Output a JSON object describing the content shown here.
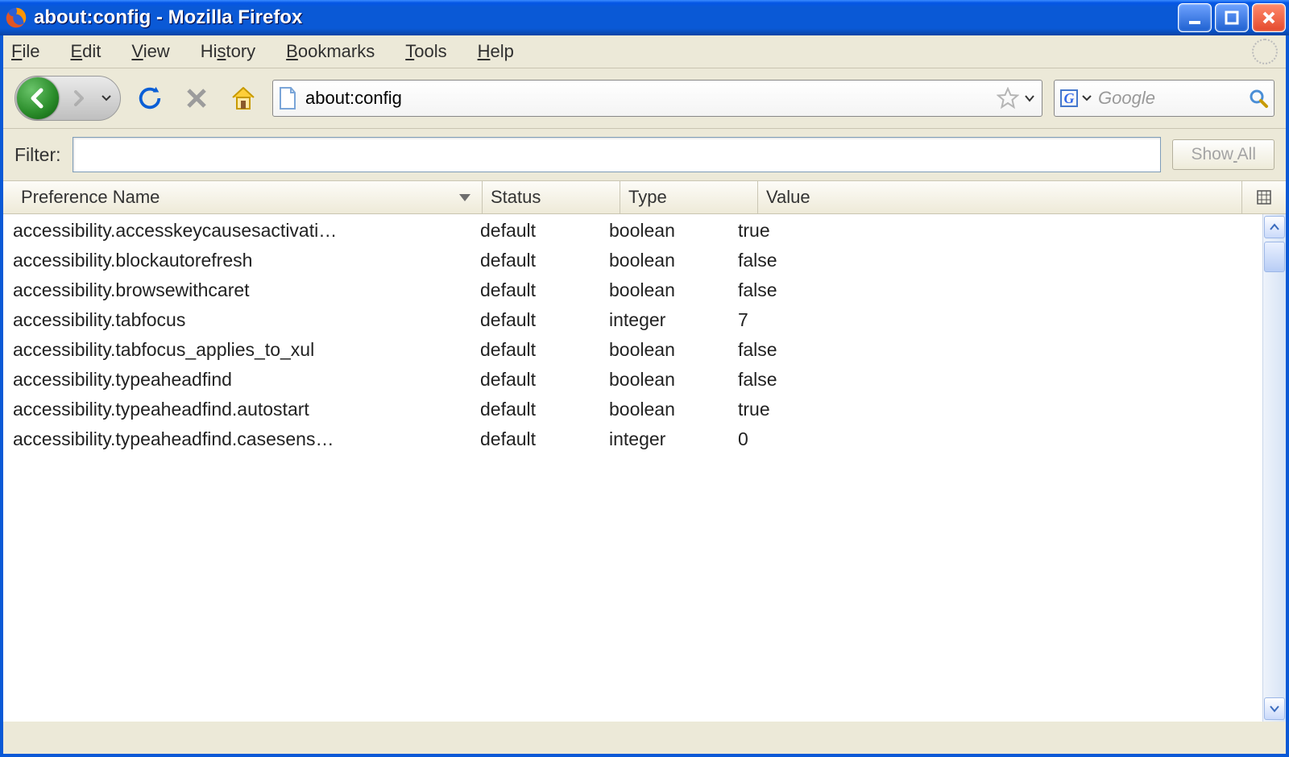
{
  "window": {
    "title": "about:config - Mozilla Firefox"
  },
  "menu": {
    "file": {
      "label": "File",
      "u": 0
    },
    "edit": {
      "label": "Edit",
      "u": 0
    },
    "view": {
      "label": "View",
      "u": 0
    },
    "history": {
      "label": "History",
      "u": 2
    },
    "bookmarks": {
      "label": "Bookmarks",
      "u": 0
    },
    "tools": {
      "label": "Tools",
      "u": 0
    },
    "help": {
      "label": "Help",
      "u": 0
    }
  },
  "url": {
    "value": "about:config"
  },
  "search": {
    "placeholder": "Google"
  },
  "filter": {
    "label": "Filter:",
    "value": "",
    "showall": "Show All",
    "showall_u": 4
  },
  "columns": {
    "name": "Preference Name",
    "status": "Status",
    "type": "Type",
    "value": "Value"
  },
  "prefs": [
    {
      "name": "accessibility.accesskeycausesactivati…",
      "status": "default",
      "type": "boolean",
      "value": "true"
    },
    {
      "name": "accessibility.blockautorefresh",
      "status": "default",
      "type": "boolean",
      "value": "false"
    },
    {
      "name": "accessibility.browsewithcaret",
      "status": "default",
      "type": "boolean",
      "value": "false"
    },
    {
      "name": "accessibility.tabfocus",
      "status": "default",
      "type": "integer",
      "value": "7"
    },
    {
      "name": "accessibility.tabfocus_applies_to_xul",
      "status": "default",
      "type": "boolean",
      "value": "false"
    },
    {
      "name": "accessibility.typeaheadfind",
      "status": "default",
      "type": "boolean",
      "value": "false"
    },
    {
      "name": "accessibility.typeaheadfind.autostart",
      "status": "default",
      "type": "boolean",
      "value": "true"
    },
    {
      "name": "accessibility.typeaheadfind.casesens…",
      "status": "default",
      "type": "integer",
      "value": "0"
    }
  ]
}
